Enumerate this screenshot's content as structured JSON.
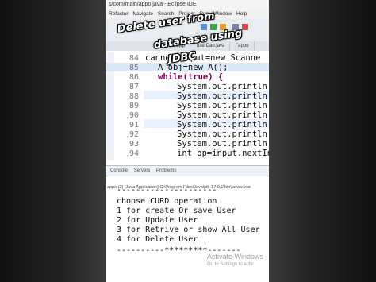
{
  "window": {
    "title": "s/com/main/appo.java - Eclipse IDE",
    "menu": [
      "Refactor",
      "Navigate",
      "Search",
      "Project",
      "Run",
      "Window",
      "Help"
    ]
  },
  "editor_tabs": [
    "Insert.jsp",
    "userDao.java",
    "\"appo"
  ],
  "overlay_text": [
    "Delete user from",
    "database using",
    "JDBC"
  ],
  "editor": {
    "lines": [
      {
        "num": "84",
        "text": "canner input=new Scanne"
      },
      {
        "num": "85",
        "text": "A obj=new A();"
      },
      {
        "num": "86",
        "text": "while(true) {"
      },
      {
        "num": "87",
        "text": "System.out.println(\""
      },
      {
        "num": "88",
        "text": "System.out.println(\""
      },
      {
        "num": "89",
        "text": "System.out.println(\""
      },
      {
        "num": "90",
        "text": "System.out.println(\""
      },
      {
        "num": "91",
        "text": "System.out.println(\""
      },
      {
        "num": "92",
        "text": "System.out.println(\""
      },
      {
        "num": "93",
        "text": "System.out.println(\""
      },
      {
        "num": "94",
        "text": "int op=input.nextInt"
      }
    ]
  },
  "console": {
    "tabs": [
      "Console",
      "Servers",
      "Problems"
    ],
    "path": "appo (2) [Java Application] C:\\Program Files\\Java\\jdk-17.0.1\\bin\\javaw.exe",
    "output": [
      "---------------------",
      "choose CURD operation",
      "1 for create Or save User",
      "2 for Update User",
      "3 for Retrive or show All User",
      "4 for Delete User",
      "----------*********-------"
    ]
  },
  "watermark": [
    "Activate Windows",
    "Go to Settings to activ"
  ]
}
